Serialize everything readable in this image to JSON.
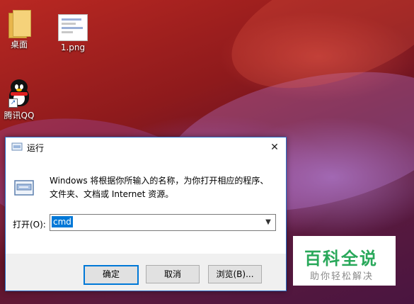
{
  "desktop": {
    "icons": [
      {
        "label": "桌面",
        "icon": "folder-icon"
      },
      {
        "label": "1.png",
        "icon": "image-file-icon"
      },
      {
        "label": "腾讯QQ",
        "icon": "qq-penguin-icon"
      }
    ]
  },
  "run_dialog": {
    "title": "运行",
    "description": "Windows 将根据你所输入的名称，为你打开相应的程序、文件夹、文档或 Internet 资源。",
    "open_label": "打开(O):",
    "command_value": "cmd",
    "ok_label": "确定",
    "cancel_label": "取消",
    "browse_label": "浏览(B)...",
    "close_symbol": "✕"
  },
  "watermark": {
    "title": "百科全说",
    "subtitle": "助你轻松解决"
  },
  "colors": {
    "accent": "#0078d7",
    "watermark_green": "#29a85a"
  }
}
